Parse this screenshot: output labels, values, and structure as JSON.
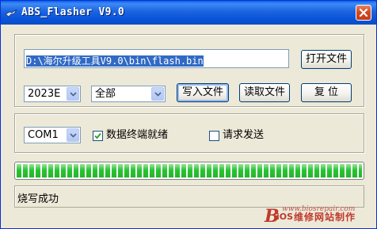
{
  "window": {
    "title": "ABS_Flasher V9.0",
    "close_icon": "close-icon",
    "app_icon": "flasher-app-icon"
  },
  "file": {
    "path": "D:\\海尔升级工具V9.0\\bin\\flash.bin",
    "open_label": "打开文件"
  },
  "controls": {
    "year_value": "2023E",
    "region_value": "全部",
    "write_label": "写入文件",
    "read_label": "读取文件",
    "reset_label": "复 位"
  },
  "serial": {
    "port_value": "COM1",
    "ready_label": "数据终端就绪",
    "ready_checked": true,
    "request_label": "请求发送",
    "request_checked": false
  },
  "progress": {
    "value_percent": 100,
    "color": "#28c430"
  },
  "status": {
    "text": "烧写成功"
  },
  "watermark": {
    "url": "www.biosrepair.com",
    "logo_b": "B",
    "logo_ios": "iOS",
    "logo_text": "维修网站制作",
    "color": "#c0392b"
  }
}
